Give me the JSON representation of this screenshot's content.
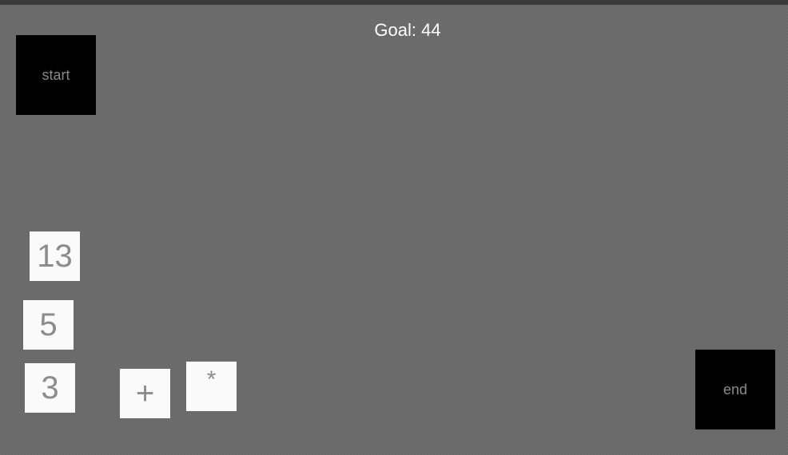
{
  "goal": {
    "label": "Goal:",
    "value": "44"
  },
  "start_zone": {
    "label": "start"
  },
  "end_zone": {
    "label": "end"
  },
  "number_tiles": [
    "13",
    "5",
    "3"
  ],
  "operator_tiles": [
    "+",
    "*"
  ]
}
